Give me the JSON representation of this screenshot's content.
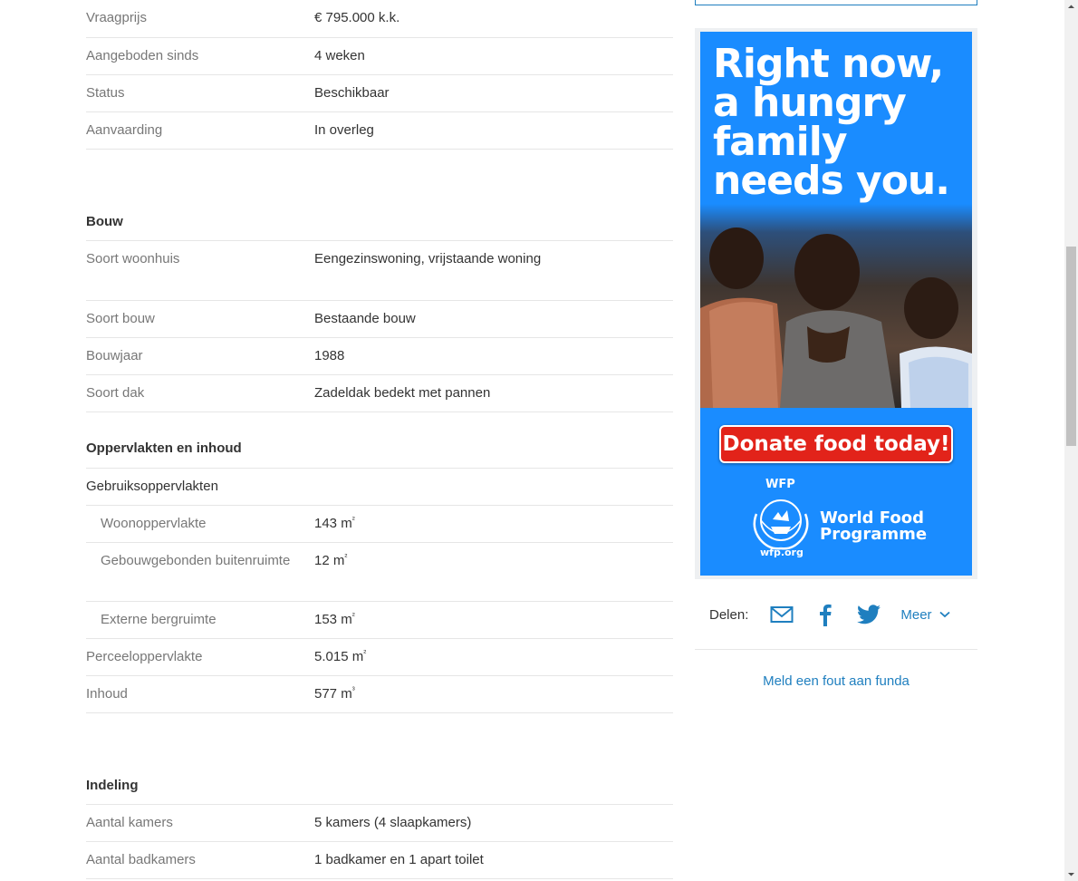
{
  "overdracht": [
    {
      "label": "Vraagprijs",
      "value": "€ 795.000 k.k."
    },
    {
      "label": "Aangeboden sinds",
      "value": "4 weken"
    },
    {
      "label": "Status",
      "value": "Beschikbaar"
    },
    {
      "label": "Aanvaarding",
      "value": "In overleg"
    }
  ],
  "bouw": {
    "title": "Bouw",
    "rows": [
      {
        "label": "Soort woonhuis",
        "value": "Eengezinswoning, vrijstaande woning"
      },
      {
        "label": "Soort bouw",
        "value": "Bestaande bouw"
      },
      {
        "label": "Bouwjaar",
        "value": "1988"
      },
      {
        "label": "Soort dak",
        "value": "Zadeldak bedekt met pannen"
      }
    ]
  },
  "oppervlakten": {
    "title": "Oppervlakten en inhoud",
    "subtitle": "Gebruiksoppervlakten",
    "rows": [
      {
        "label": "Woonoppervlakte",
        "value": "143 m",
        "unit_sup": "²"
      },
      {
        "label": "Gebouwgebonden buitenruimte",
        "value": "12 m",
        "unit_sup": "²"
      },
      {
        "label": "Externe bergruimte",
        "value": "153 m",
        "unit_sup": "²"
      },
      {
        "label": "Perceeloppervlakte",
        "value": "5.015 m",
        "unit_sup": "²"
      },
      {
        "label": "Inhoud",
        "value": "577 m",
        "unit_sup": "³"
      }
    ]
  },
  "indeling": {
    "title": "Indeling",
    "rows": [
      {
        "label": "Aantal kamers",
        "value": "5 kamers (4 slaapkamers)"
      },
      {
        "label": "Aantal badkamers",
        "value": "1 badkamer en 1 apart toilet"
      }
    ]
  },
  "ad": {
    "headline": "Right now, a hungry family needs you.",
    "cta": "Donate food today!",
    "wfp_label": "WFP",
    "org_name": "World Food Programme",
    "url": "wfp.org",
    "background_color": "#1a8cff",
    "cta_color": "#e2231a"
  },
  "share": {
    "label": "Delen:",
    "icons": [
      "mail-icon",
      "facebook-icon",
      "twitter-icon"
    ],
    "more_label": "Meer"
  },
  "report_link": "Meld een fout aan funda",
  "colors": {
    "accent": "#1f7fbf",
    "label_gray": "#777777",
    "border": "#e6e6e6"
  }
}
